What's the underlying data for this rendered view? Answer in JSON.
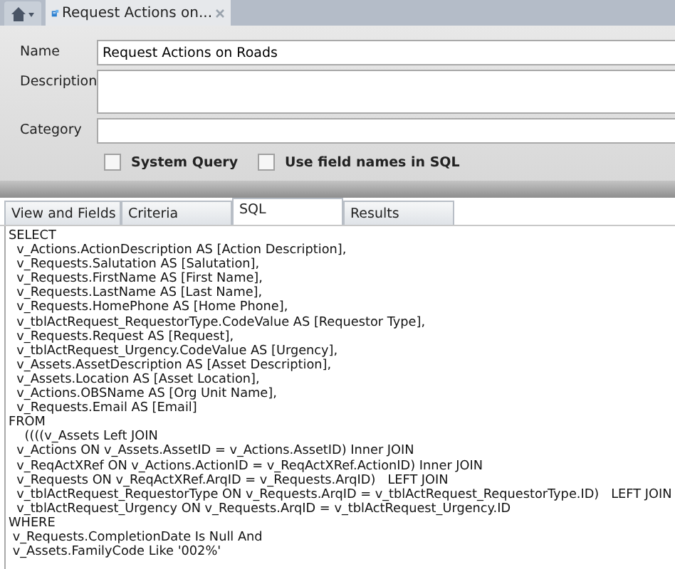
{
  "doc_tabs": [
    {
      "label": "Request Actions on...",
      "selected": true
    }
  ],
  "form": {
    "fields": [
      {
        "label": "Name",
        "value": "Request Actions on Roads",
        "kind": "single"
      },
      {
        "label": "Description",
        "kind": "multi"
      },
      {
        "label": "Category",
        "kind": "single"
      }
    ],
    "checkboxes": [
      {
        "label": "System Query",
        "checked": false
      },
      {
        "label": "Use field names in SQL",
        "checked": false
      }
    ]
  },
  "tabs": [
    {
      "label": "View and Fields",
      "selected": false
    },
    {
      "label": "Criteria",
      "selected": false
    },
    {
      "label": "SQL",
      "selected": true
    },
    {
      "label": "Results",
      "selected": false
    }
  ],
  "sql_lines": [
    "SELECT",
    "  v_Actions.ActionDescription AS [Action Description],",
    "  v_Requests.Salutation AS [Salutation],",
    "  v_Requests.FirstName AS [First Name],",
    "  v_Requests.LastName AS [Last Name],",
    "  v_Requests.HomePhone AS [Home Phone],",
    "  v_tblActRequest_RequestorType.CodeValue AS [Requestor Type],",
    "  v_Requests.Request AS [Request],",
    "  v_tblActRequest_Urgency.CodeValue AS [Urgency],",
    "  v_Assets.AssetDescription AS [Asset Description],",
    "  v_Assets.Location AS [Asset Location],",
    "  v_Actions.OBSName AS [Org Unit Name],",
    "  v_Requests.Email AS [Email]",
    "FROM",
    "    ((((v_Assets Left JOIN",
    "  v_Actions ON v_Assets.AssetID = v_Actions.AssetID) Inner JOIN",
    "  v_ReqActXRef ON v_Actions.ActionID = v_ReqActXRef.ActionID) Inner JOIN",
    "  v_Requests ON v_ReqActXRef.ArqID = v_Requests.ArqID)   LEFT JOIN",
    "  v_tblActRequest_RequestorType ON v_Requests.ArqID = v_tblActRequest_RequestorType.ID)   LEFT JOIN",
    "  v_tblActRequest_Urgency ON v_Requests.ArqID = v_tblActRequest_Urgency.ID",
    "WHERE",
    " v_Requests.CompletionDate Is Null And",
    " v_Assets.FamilyCode Like '002%'"
  ]
}
